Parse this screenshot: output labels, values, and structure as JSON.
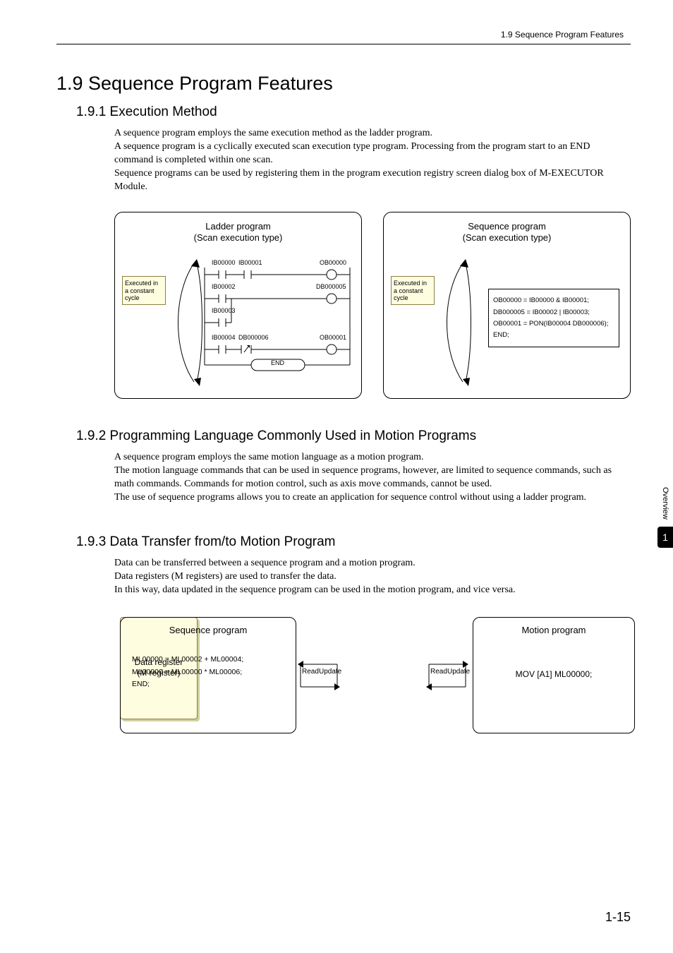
{
  "header": {
    "breadcrumb": "1.9  Sequence Program Features"
  },
  "section": {
    "number_title": "1.9  Sequence Program Features",
    "s1": {
      "heading": "1.9.1  Execution Method",
      "p": "A sequence program employs the same execution method as the ladder program.\nA sequence program is a cyclically executed scan execution type program. Processing from the program start to an END command is completed within one scan.\nSequence programs can be used by registering them in the program execution registry screen dialog box of M-EXECUTOR Module."
    },
    "s2": {
      "heading": "1.9.2  Programming Language Commonly Used in Motion Programs",
      "p": "A sequence program employs the same motion language as a motion program.\nThe motion language commands that can be used in sequence programs, however, are limited to sequence commands, such as math commands. Commands for motion control, such as axis move commands, cannot be used.\nThe use of sequence programs allows you to create an application for sequence control without using a ladder program."
    },
    "s3": {
      "heading": "1.9.3  Data Transfer from/to Motion Program",
      "p": "Data can be transferred between a sequence program and a motion program.\nData registers (M registers) are used to transfer the data.\nIn this way, data updated in the sequence program can be used in the motion program, and vice versa."
    }
  },
  "fig1": {
    "left_title": "Ladder program\n(Scan execution type)",
    "right_title": "Sequence program\n(Scan execution type)",
    "exec_tag": "Executed in a constant cycle",
    "ladder_labels": {
      "r1a": "IB00000",
      "r1b": "IB00001",
      "r1c": "OB00000",
      "r2a": "IB00002",
      "r2c": "DB000005",
      "r3a": "IB00003",
      "r4a": "IB00004",
      "r4b": "DB000006",
      "r4c": "OB00001",
      "end": "END"
    },
    "seq_lines": {
      "l1": "OB00000 = IB00000 & IB00001;",
      "l2": "DB000005 = IB00002 | IB00003;",
      "l3": "OB00001 = PON(IB00004 DB000006);",
      "l4": "END;"
    }
  },
  "fig2": {
    "seq_title": "Sequence program",
    "mot_title": "Motion program",
    "seq_code": {
      "l1": "ML00000 = ML00002 + ML00004;",
      "l2": "ML00000 = ML00000 * ML00006;",
      "l3": "END;"
    },
    "mid": "Data register\n(M register)",
    "mot_code": "MOV [A1] ML00000;",
    "arrows": {
      "read": "Read",
      "update": "Update"
    }
  },
  "side": {
    "label": "Overview",
    "num": "1"
  },
  "footer": {
    "page": "1-15"
  }
}
